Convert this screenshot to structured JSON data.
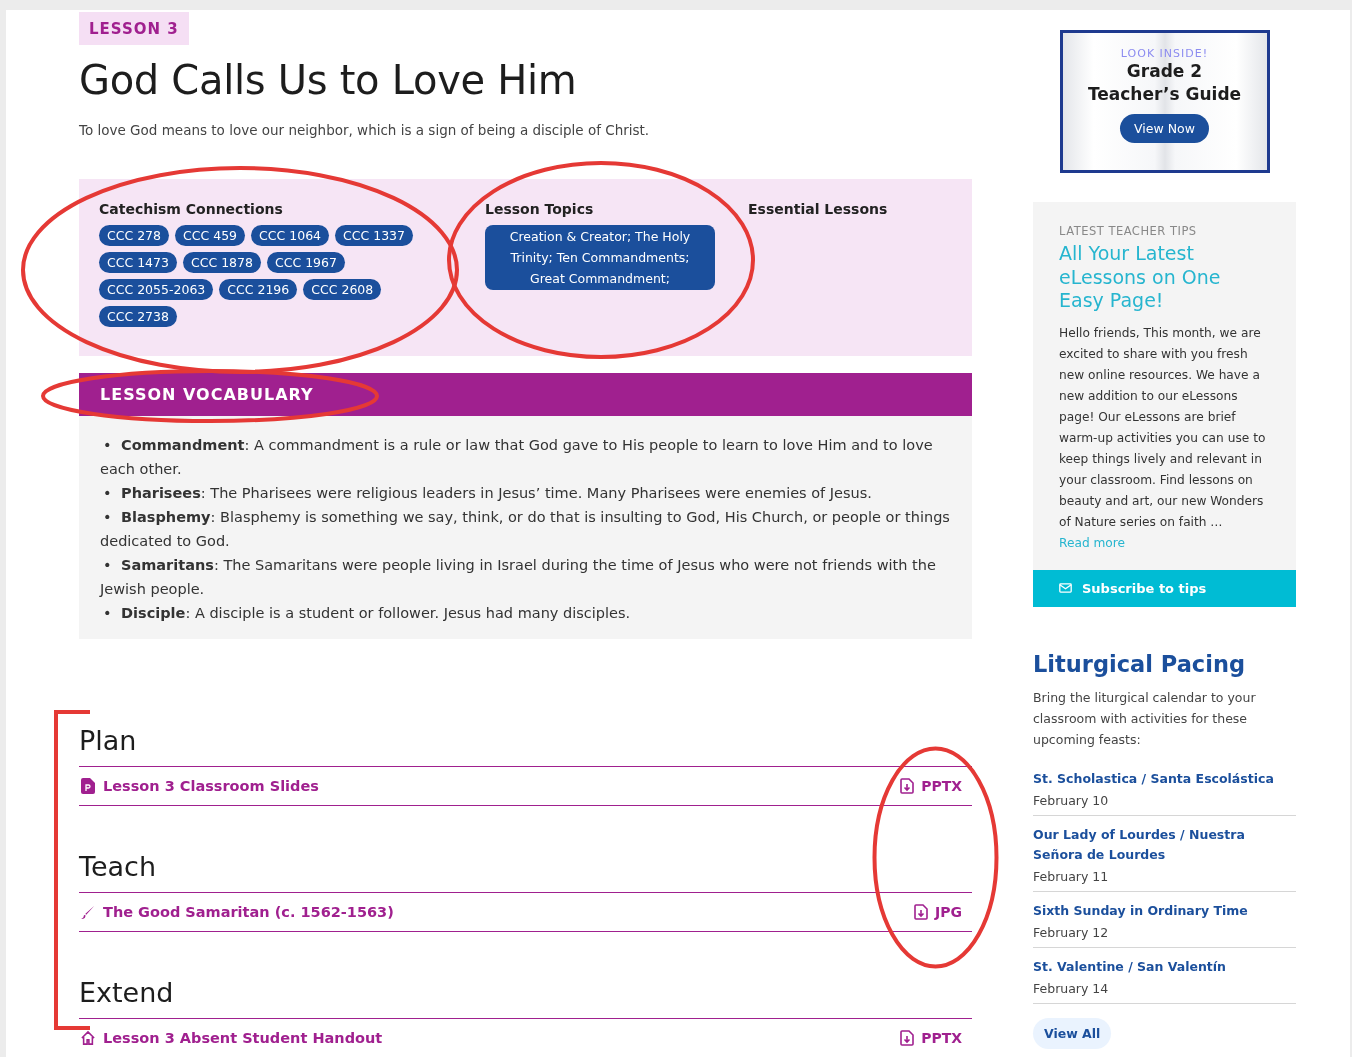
{
  "lesson_badge": "LESSON 3",
  "title": "God Calls Us to Love Him",
  "subtitle": "To love God means to love our neighbor, which is a sign of being a disciple of Christ.",
  "connections": {
    "catechism": {
      "heading": "Catechism Connections",
      "tags": [
        "CCC 278",
        "CCC 459",
        "CCC 1064",
        "CCC 1337",
        "CCC 1473",
        "CCC 1878",
        "CCC 1967",
        "CCC 2055-2063",
        "CCC 2196",
        "CCC 2608",
        "CCC 2738"
      ]
    },
    "topics": {
      "heading": "Lesson Topics",
      "tags": [
        "Creation & Creator; The Holy Trinity; Ten Commandments; Great Commandment;"
      ]
    },
    "essential": {
      "heading": "Essential Lessons"
    }
  },
  "vocabulary": {
    "heading": "LESSON VOCABULARY",
    "bullet": "•",
    "items": [
      "**Commandment**: A commandment is a rule or law that God gave to His people to learn to love Him and to love each other.",
      "**Pharisees**: The Pharisees were religious leaders in Jesus’ time. Many Pharisees were enemies of Jesus.",
      "**Blasphemy**: Blasphemy is something we say, think, or do that is insulting to God, His Church, or people or things dedicated to God.",
      "**Samaritans**: The Samaritans were people living in Israel during the time of Jesus who were not friends with the Jewish people.",
      "**Disciple**: A disciple is a student or follower. Jesus had many disciples."
    ]
  },
  "sections": [
    {
      "heading": "Plan",
      "resources": [
        {
          "kind": "slides",
          "title": "Lesson 3 Classroom Slides",
          "file_type": "PPTX"
        }
      ]
    },
    {
      "heading": "Teach",
      "resources": [
        {
          "kind": "art",
          "title": "The Good Samaritan (c. 1562-1563)",
          "file_type": "JPG"
        }
      ]
    },
    {
      "heading": "Extend",
      "resources": [
        {
          "kind": "home",
          "title": "Lesson 3 Absent Student Handout",
          "file_type": "PPTX"
        }
      ]
    }
  ],
  "sidebar": {
    "guide": {
      "eyebrow": "LOOK INSIDE!",
      "title_line_1": "Grade 2",
      "title_line_2": "Teacher’s Guide",
      "button": "View Now"
    },
    "tips": {
      "eyebrow": "LATEST TEACHER TIPS",
      "headline": "All Your Latest eLessons on One Easy Page!",
      "body": "Hello friends, This month, we are excited to share with you fresh new online resources.  We have a new addition to our eLessons page! Our eLessons are brief warm-up activities you can use to keep things lively and relevant in your classroom. Find lessons on beauty and art, our new Wonders of Nature series on faith …",
      "read_more": "Read more",
      "subscribe": "Subscribe to tips"
    },
    "pacing": {
      "heading": "Liturgical Pacing",
      "intro": "Bring the liturgical calendar to your classroom with activities for these upcoming feasts:",
      "feasts": [
        {
          "name": "St. Scholastica / Santa Escolástica",
          "date": "February 10"
        },
        {
          "name": "Our Lady of Lourdes / Nuestra Señora de Lourdes",
          "date": "February 11"
        },
        {
          "name": "Sixth Sunday in Ordinary Time",
          "date": "February 12"
        },
        {
          "name": "St. Valentine / San Valentín",
          "date": "February 14"
        }
      ],
      "view_all": "View All"
    }
  }
}
